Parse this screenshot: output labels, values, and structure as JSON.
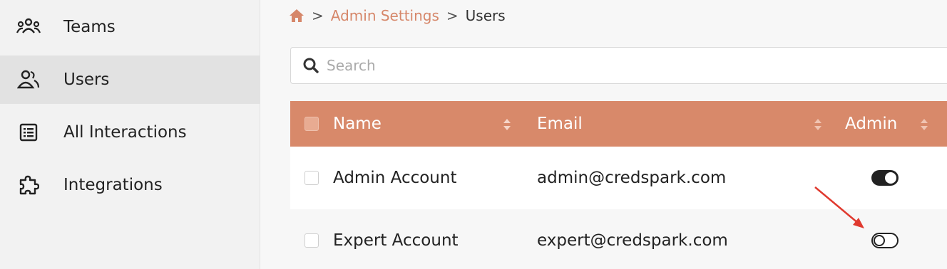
{
  "sidebar": {
    "items": [
      {
        "label": "Teams",
        "icon": "teams-icon",
        "active": false
      },
      {
        "label": "Users",
        "icon": "users-icon",
        "active": true
      },
      {
        "label": "All Interactions",
        "icon": "list-icon",
        "active": false
      },
      {
        "label": "Integrations",
        "icon": "puzzle-icon",
        "active": false
      }
    ]
  },
  "breadcrumb": {
    "home_icon": "home-icon",
    "separator": ">",
    "parent": "Admin Settings",
    "current": "Users"
  },
  "search": {
    "placeholder": "Search",
    "value": ""
  },
  "table": {
    "columns": {
      "name": "Name",
      "email": "Email",
      "admin": "Admin"
    },
    "rows": [
      {
        "name": "Admin Account",
        "email": "admin@credspark.com",
        "admin": true
      },
      {
        "name": "Expert Account",
        "email": "expert@credspark.com",
        "admin": false
      }
    ]
  },
  "colors": {
    "accent": "#d8896a",
    "link": "#d6876a",
    "annotation_arrow": "#e03a2f"
  }
}
